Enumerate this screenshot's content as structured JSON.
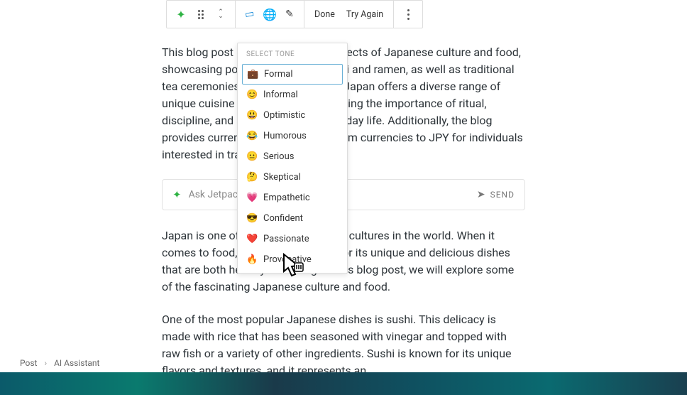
{
  "toolbar": {
    "done_label": "Done",
    "try_again_label": "Try Again"
  },
  "dropdown": {
    "header": "SELECT TONE",
    "items": [
      {
        "emoji": "💼",
        "label": "Formal"
      },
      {
        "emoji": "😊",
        "label": "Informal"
      },
      {
        "emoji": "😃",
        "label": "Optimistic"
      },
      {
        "emoji": "😂",
        "label": "Humorous"
      },
      {
        "emoji": "😐",
        "label": "Serious"
      },
      {
        "emoji": "🤔",
        "label": "Skeptical"
      },
      {
        "emoji": "💗",
        "label": "Empathetic"
      },
      {
        "emoji": "😎",
        "label": "Confident"
      },
      {
        "emoji": "❤️",
        "label": "Passionate"
      },
      {
        "emoji": "🔥",
        "label": "Provocative"
      }
    ]
  },
  "paragraphs": {
    "p1": "This blog post highlights various aspects of Japanese culture and food, showcasing popular dishes like sushi and ramen, as well as traditional tea ceremonies and kaiseki cuisine. Japan offers a diverse range of unique cuisine and culture, emphasizing the importance of ritual, discipline, and appreciation for everyday life. Additionally, the blog provides currency exchange rates from currencies to JPY for individuals interested in traveling to Japan.",
    "p2": "Japan is one of the most fascinating cultures in the world. When it comes to food, Japan is renowned for its unique and delicious dishes that are both healthy and filling. In this blog post, we will explore some of the fascinating Japanese culture and food.",
    "p3": "One of the most popular Japanese dishes is sushi. This delicacy is made with rice that has been seasoned with vinegar and topped with raw fish or a variety of other ingredients. Sushi is known for its unique flavors and textures, and it represents an"
  },
  "ask_bar": {
    "placeholder": "Ask Jetpack AI",
    "send_label": "SEND"
  },
  "breadcrumb": {
    "root": "Post",
    "current": "AI Assistant"
  }
}
